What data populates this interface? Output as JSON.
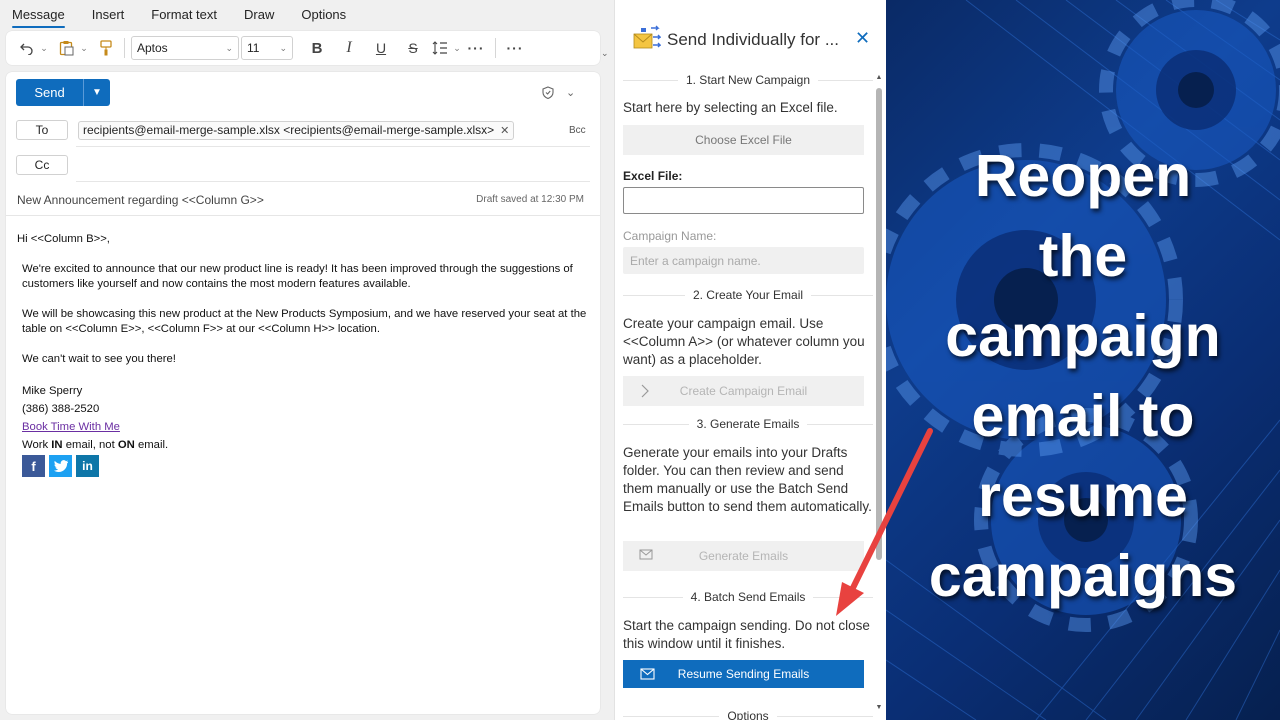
{
  "ribbon": {
    "tabs": [
      {
        "label": "Message"
      },
      {
        "label": "Insert"
      },
      {
        "label": "Format text"
      },
      {
        "label": "Draw"
      },
      {
        "label": "Options"
      }
    ],
    "font": "Aptos",
    "font_size": "11"
  },
  "compose": {
    "send_label": "Send",
    "to_label": "To",
    "cc_label": "Cc",
    "bcc_label": "Bcc",
    "recipient": "recipients@email-merge-sample.xlsx <recipients@email-merge-sample.xlsx>",
    "subject": "New Announcement regarding <<Column G>>",
    "draft_status": "Draft saved at 12:30 PM",
    "greeting": "Hi <<Column B>>,",
    "para1": "We're excited to announce that our new product line is ready!  It has been improved through the suggestions of customers like yourself and now contains the most modern features available.",
    "para2": "We will be showcasing this new product at the New Products Symposium, and we have reserved your seat at the table on <<Column E>>, <<Column F>> at our <<Column H>> location.",
    "para3": "We can't wait to see you there!",
    "sig_name": "Mike Sperry",
    "sig_phone": "(386) 388-2520",
    "sig_link": "Book Time With Me",
    "sig_tag_1": "Work ",
    "sig_tag_in": "IN",
    "sig_tag_2": " email, not ",
    "sig_tag_on": "ON",
    "sig_tag_3": " email.",
    "social": [
      {
        "icon": "facebook-icon",
        "glyph": "f",
        "color": "#3b5998"
      },
      {
        "icon": "twitter-icon",
        "glyph": "t",
        "color": "#1da1f2"
      },
      {
        "icon": "linkedin-icon",
        "glyph": "in",
        "color": "#0e76a8"
      }
    ]
  },
  "addin": {
    "title": "Send Individually for ...",
    "s1_head": "1. Start New Campaign",
    "s1_text": "Start here by selecting an Excel file.",
    "choose_btn": "Choose Excel File",
    "excel_label": "Excel File:",
    "excel_value": "",
    "campaign_label": "Campaign Name:",
    "campaign_placeholder": "Enter a campaign name.",
    "s2_head": "2. Create Your Email",
    "s2_text": "Create your campaign email. Use <<Column A>> (or whatever column you want) as a placeholder.",
    "create_btn": "Create Campaign Email",
    "s3_head": "3. Generate Emails",
    "s3_text": "Generate your emails into your Drafts folder. You can then review and send them manually or use the Batch Send Emails button to send them automatically.",
    "generate_btn": "Generate Emails",
    "s4_head": "4. Batch Send Emails",
    "s4_text": "Start the campaign sending. Do not close this window until it finishes.",
    "resume_btn": "Resume Sending Emails",
    "options_head": "Options"
  },
  "promo": {
    "lines": [
      "Reopen",
      "the",
      "campaign",
      "email to",
      "resume",
      "campaigns"
    ],
    "arrow_color": "#e8423f"
  }
}
